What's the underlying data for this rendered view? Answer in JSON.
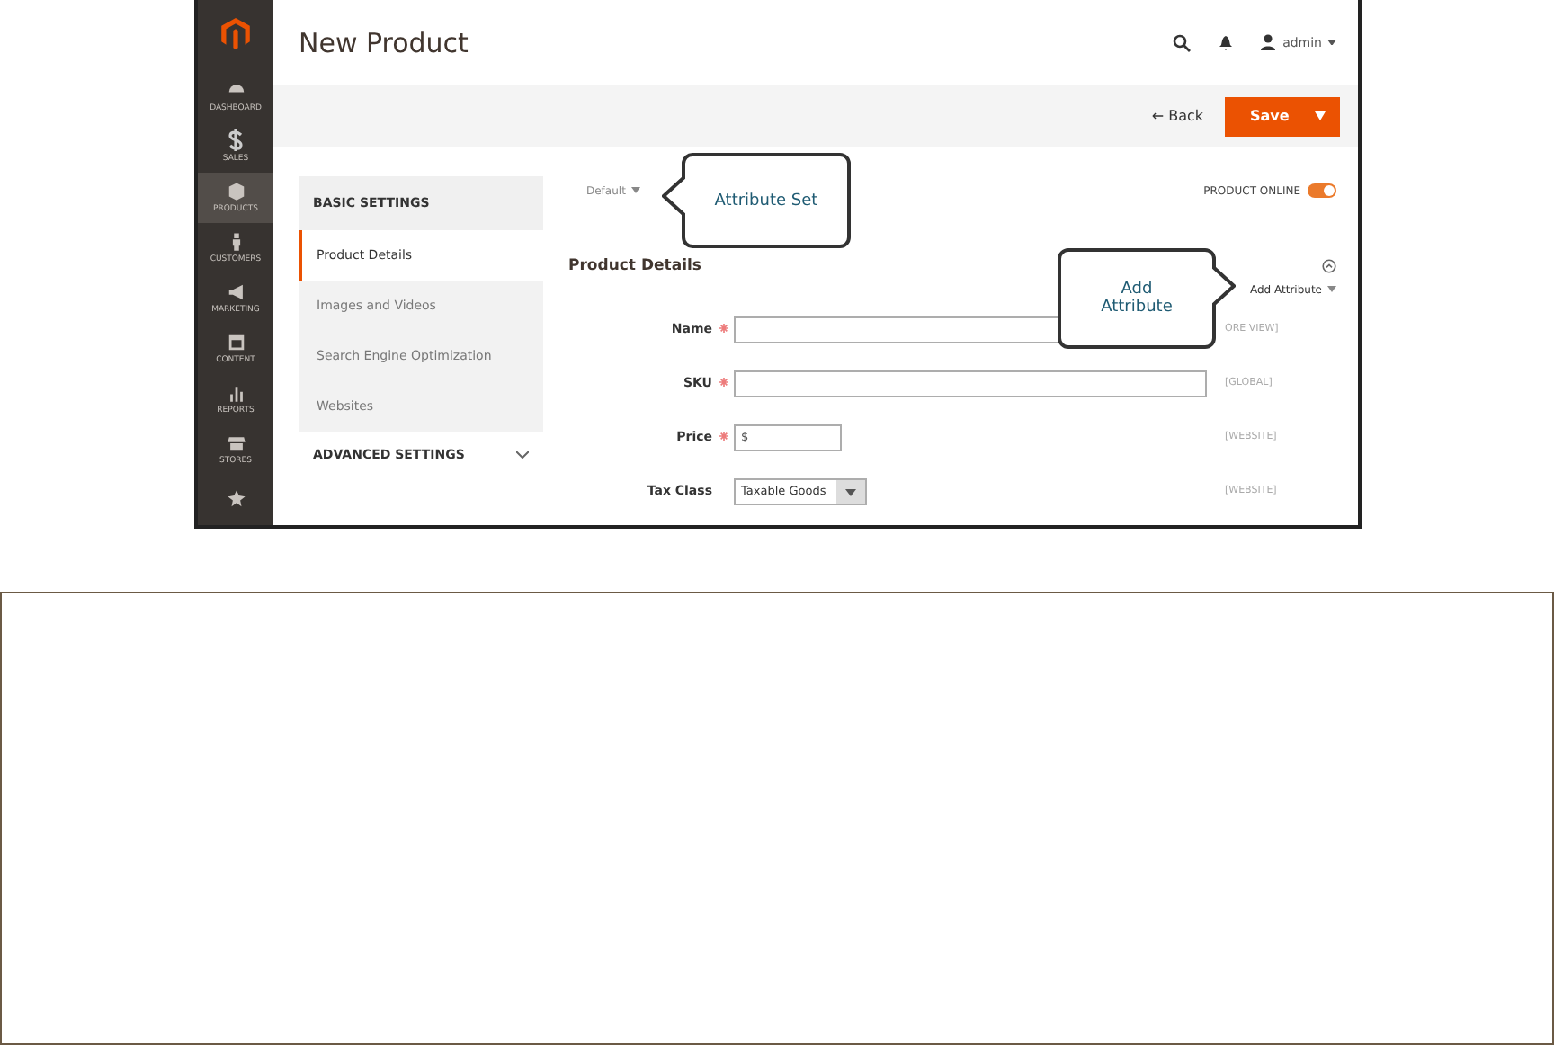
{
  "sidebar": {
    "items": [
      {
        "label": "DASHBOARD",
        "selected": false
      },
      {
        "label": "SALES",
        "selected": false
      },
      {
        "label": "PRODUCTS",
        "selected": true
      },
      {
        "label": "CUSTOMERS",
        "selected": false
      },
      {
        "label": "MARKETING",
        "selected": false
      },
      {
        "label": "CONTENT",
        "selected": false
      },
      {
        "label": "REPORTS",
        "selected": false
      },
      {
        "label": "STORES",
        "selected": false
      },
      {
        "selected": false
      }
    ]
  },
  "header": {
    "title": "New Product",
    "user": "admin"
  },
  "actions": {
    "back": "← Back",
    "save": "Save"
  },
  "tabs": {
    "basic_heading": "BASIC SETTINGS",
    "items": [
      {
        "label": "Product Details",
        "selected": true
      },
      {
        "label": "Images and Videos",
        "selected": false
      },
      {
        "label": "Search Engine Optimization",
        "selected": false
      },
      {
        "label": "Websites",
        "selected": false
      }
    ],
    "advanced_heading": "ADVANCED SETTINGS"
  },
  "attribute_set": "Default",
  "product_online": {
    "label": "PRODUCT ONLINE",
    "on": true
  },
  "section_title": "Product Details",
  "add_attribute": "Add Attribute",
  "fields": [
    {
      "kind": "text",
      "label": "Name",
      "required": true,
      "scope": "ORE VIEW]"
    },
    {
      "kind": "text",
      "label": "SKU",
      "required": true,
      "scope": "[GLOBAL]"
    },
    {
      "kind": "price",
      "label": "Price",
      "required": true,
      "value": "$",
      "scope": "[WEBSITE]"
    },
    {
      "kind": "select",
      "label": "Tax Class",
      "required": false,
      "value": "Taxable Goods",
      "scope": "[WEBSITE]"
    }
  ],
  "callouts": [
    {
      "text": "Attribute Set"
    },
    {
      "text": "Add Attribute"
    }
  ]
}
